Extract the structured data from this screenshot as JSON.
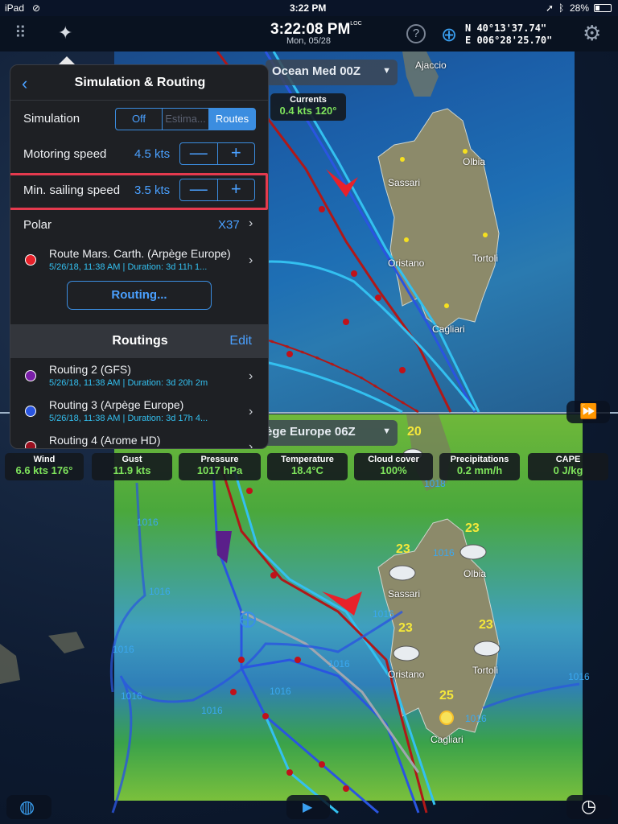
{
  "status": {
    "device": "iPad",
    "time": "3:22 PM",
    "battery": "28%"
  },
  "toolbar": {
    "clock": "3:22:08 PM",
    "clock_suffix": "LOC",
    "date": "Mon, 05/28",
    "lat": "N  40°13'37.74\"",
    "lon": "E  006°28'25.70\""
  },
  "models": {
    "top": "Ocean Med 00Z",
    "bottom": "ège Europe 06Z"
  },
  "currents": {
    "label": "Currents",
    "value": "0.4 kts 120°"
  },
  "chips": [
    {
      "label": "Wind",
      "value": "6.6 kts 176°"
    },
    {
      "label": "Gust",
      "value": "11.9 kts"
    },
    {
      "label": "Pressure",
      "value": "1017 hPa"
    },
    {
      "label": "Temperature",
      "value": "18.4°C"
    },
    {
      "label": "Cloud cover",
      "value": "100%"
    },
    {
      "label": "Precipitations",
      "value": "0.2 mm/h"
    },
    {
      "label": "CAPE",
      "value": "0 J/kg"
    }
  ],
  "panel": {
    "title": "Simulation & Routing",
    "simulation_label": "Simulation",
    "seg_off": "Off",
    "seg_estim": "Estima...",
    "seg_routes": "Routes",
    "motoring_label": "Motoring speed",
    "motoring_value": "4.5 kts",
    "min_sailing_label": "Min. sailing speed",
    "min_sailing_value": "3.5 kts",
    "minus": "—",
    "plus": "+",
    "polar_label": "Polar",
    "polar_value": "X37",
    "route_name": "Route Mars. Carth. (Arpège Europe)",
    "route_meta": "5/26/18, 11:38 AM | Duration: 3d 11h 1...",
    "routing_button": "Routing...",
    "routings_title": "Routings",
    "routings_edit": "Edit",
    "routings": [
      {
        "name": "Routing 2 (GFS)",
        "meta": "5/26/18, 11:38 AM | Duration: 3d 20h 2m",
        "color": "#7a1fa8"
      },
      {
        "name": "Routing 3 (Arpège Europe)",
        "meta": "5/26/18, 11:38 AM | Duration: 3d 17h 4...",
        "color": "#2a55e0"
      },
      {
        "name": "Routing 4 (Arome HD)",
        "meta": "",
        "color": "#9a1020"
      }
    ],
    "route_color": "#e8212a"
  },
  "places": {
    "ajaccio": "Ajaccio",
    "olbia": "Olbia",
    "sassari": "Sassari",
    "oristano": "Oristano",
    "tortoli": "Tortoli",
    "cagliari": "Cagliari"
  },
  "temps": {
    "t20": "20",
    "t23a": "23",
    "t23b": "23",
    "t23c": "23",
    "t23d": "23",
    "t25": "25"
  },
  "isobar": "1016",
  "isobar_top": "1018"
}
